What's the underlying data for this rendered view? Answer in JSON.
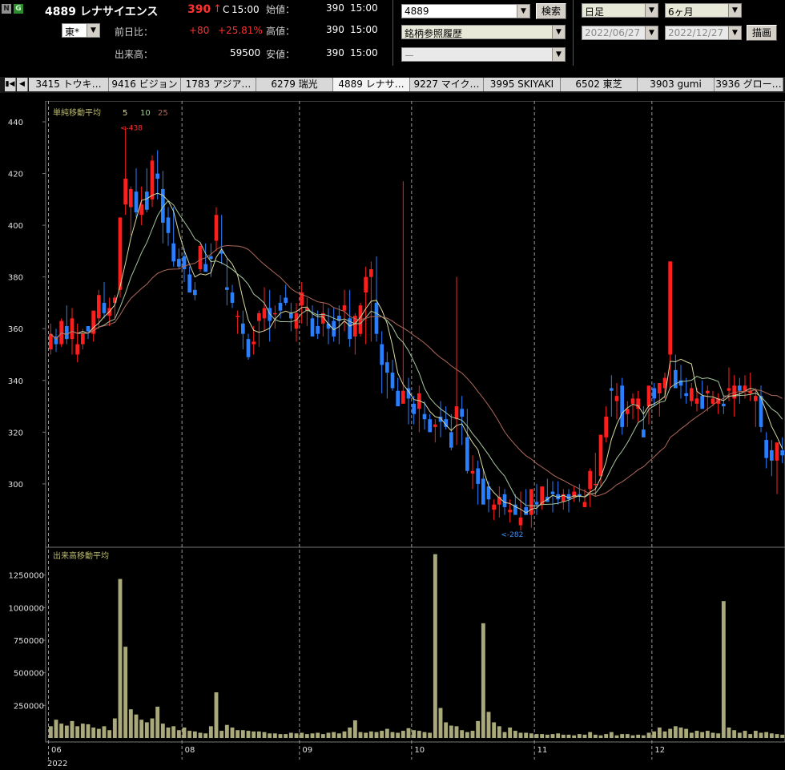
{
  "colors": {
    "up": "#ff1e1e",
    "down": "#2a7fff",
    "ma5": "#d8d8a0",
    "ma10": "#a8c8a0",
    "ma25": "#b06a5a",
    "volume": "#aaa97a",
    "grid": "#777777"
  },
  "header": {
    "badge_n": "N",
    "badge_g": "G",
    "code_name": "4889 レナサイエンス",
    "price": "390",
    "price_arrow": "↑",
    "price_mark": "C",
    "price_time": "15:00",
    "exchange": "東*",
    "change_label": "前日比：",
    "change": "+80",
    "change_pct": "+25.81%",
    "volume_label": "出来高：",
    "volume": "59500",
    "open_label": "始値：",
    "open": "390",
    "open_time": "15:00",
    "high_label": "高値：",
    "high": "390",
    "high_time": "15:00",
    "low_label": "安値：",
    "low": "390",
    "low_time": "15:00",
    "search_value": "4889",
    "search_button": "検索",
    "history_select": "銘柄参照履歴",
    "third_select": "ー",
    "period_select": "日足",
    "range_select": "6ヶ月",
    "date_from": "2022/06/27",
    "date_to": "2022/12/27",
    "draw_button": "描画"
  },
  "tabs": [
    {
      "label": "3415 トウキ…"
    },
    {
      "label": "9416 ビジョン"
    },
    {
      "label": "1783 アジア…"
    },
    {
      "label": "6279 瑞光"
    },
    {
      "label": "4889 レナサ…",
      "active": true
    },
    {
      "label": "9227 マイク…"
    },
    {
      "label": "3995 SKIYAKI"
    },
    {
      "label": "6502 東芝"
    },
    {
      "label": "3903 gumi"
    },
    {
      "label": "3936 グロー…"
    }
  ],
  "chart_data": {
    "type": "candlestick",
    "price_legend": "単純移動平均",
    "ma_periods": [
      "5",
      "10",
      "25"
    ],
    "volume_legend": "出来高移動平均",
    "price_ylim": [
      282,
      440
    ],
    "price_ticks": [
      "440",
      "420",
      "400",
      "380",
      "360",
      "340",
      "320",
      "300"
    ],
    "volume_ylim": [
      0,
      1500000
    ],
    "volume_ticks": [
      "1250000",
      "1000000",
      "750000",
      "500000",
      "250000"
    ],
    "month_labels": [
      {
        "label": "06",
        "index": 0
      },
      {
        "label": "08",
        "index": 25
      },
      {
        "label": "09",
        "index": 47
      },
      {
        "label": "10",
        "index": 68
      },
      {
        "label": "11",
        "index": 91
      },
      {
        "label": "12",
        "index": 113
      }
    ],
    "year_label": "2022",
    "high_marker": "438",
    "high_marker_index": 13,
    "low_marker": "282",
    "low_marker_index": 84,
    "candles": [
      [
        352,
        362,
        350,
        358
      ],
      [
        357,
        360,
        351,
        354
      ],
      [
        354,
        364,
        353,
        363
      ],
      [
        361,
        369,
        354,
        356
      ],
      [
        356,
        368,
        350,
        364
      ],
      [
        350,
        362,
        347,
        354
      ],
      [
        354,
        360,
        352,
        358
      ],
      [
        361,
        360,
        356,
        359
      ],
      [
        358,
        362,
        355,
        367
      ],
      [
        364,
        375,
        360,
        373
      ],
      [
        370,
        378,
        364,
        366
      ],
      [
        365,
        372,
        361,
        368
      ],
      [
        370,
        373,
        364,
        372
      ],
      [
        375,
        390,
        372,
        403
      ],
      [
        408,
        438,
        404,
        418
      ],
      [
        407,
        415,
        396,
        414
      ],
      [
        413,
        422,
        403,
        405
      ],
      [
        404,
        415,
        400,
        408
      ],
      [
        413,
        422,
        405,
        406
      ],
      [
        410,
        427,
        407,
        425
      ],
      [
        420,
        429,
        410,
        418
      ],
      [
        414,
        421,
        393,
        401
      ],
      [
        403,
        407,
        392,
        397
      ],
      [
        393,
        407,
        384,
        386
      ],
      [
        387,
        391,
        383,
        384
      ],
      [
        388,
        391,
        378,
        383
      ],
      [
        381,
        384,
        374,
        374
      ],
      [
        375,
        378,
        371,
        373
      ],
      [
        383,
        393,
        382,
        392
      ],
      [
        385,
        393,
        383,
        382
      ],
      [
        388,
        393,
        380,
        387
      ],
      [
        394,
        407,
        390,
        404
      ],
      [
        390,
        404,
        385,
        389
      ],
      [
        376,
        387,
        369,
        375
      ],
      [
        374,
        377,
        368,
        370
      ],
      [
        365,
        367,
        358,
        365
      ],
      [
        362,
        367,
        352,
        358
      ],
      [
        356,
        358,
        348,
        349
      ],
      [
        354,
        361,
        350,
        355
      ],
      [
        363,
        367,
        353,
        366
      ],
      [
        364,
        376,
        359,
        368
      ],
      [
        368,
        375,
        355,
        363
      ],
      [
        366,
        369,
        360,
        366
      ],
      [
        370,
        373,
        364,
        367
      ],
      [
        372,
        377,
        369,
        370
      ],
      [
        366,
        370,
        359,
        364
      ],
      [
        360,
        370,
        355,
        366
      ],
      [
        369,
        378,
        362,
        374
      ],
      [
        367,
        372,
        361,
        368
      ],
      [
        364,
        369,
        357,
        357
      ],
      [
        361,
        367,
        356,
        358
      ],
      [
        362,
        370,
        357,
        366
      ],
      [
        362,
        368,
        354,
        360
      ],
      [
        363,
        368,
        355,
        357
      ],
      [
        365,
        369,
        354,
        363
      ],
      [
        367,
        375,
        359,
        369
      ],
      [
        364,
        375,
        353,
        356
      ],
      [
        357,
        366,
        350,
        365
      ],
      [
        358,
        370,
        357,
        369
      ],
      [
        374,
        384,
        354,
        380
      ],
      [
        380,
        386,
        355,
        383
      ],
      [
        370,
        388,
        355,
        358
      ],
      [
        354,
        359,
        335,
        346
      ],
      [
        347,
        351,
        333,
        343
      ],
      [
        343,
        348,
        336,
        337
      ],
      [
        336,
        341,
        330,
        330
      ],
      [
        331,
        417,
        331,
        336
      ],
      [
        337,
        341,
        323,
        333
      ],
      [
        331,
        334,
        323,
        327
      ],
      [
        329,
        338,
        320,
        335
      ],
      [
        327,
        332,
        321,
        325
      ],
      [
        325,
        327,
        320,
        320
      ],
      [
        322,
        325,
        316,
        323
      ],
      [
        326,
        332,
        318,
        324
      ],
      [
        325,
        330,
        321,
        322
      ],
      [
        320,
        327,
        313,
        314
      ],
      [
        325,
        380,
        315,
        330
      ],
      [
        329,
        334,
        315,
        326
      ],
      [
        318,
        329,
        304,
        305
      ],
      [
        304,
        311,
        298,
        305
      ],
      [
        306,
        309,
        292,
        300
      ],
      [
        302,
        306,
        295,
        292
      ],
      [
        299,
        301,
        289,
        294
      ],
      [
        290,
        294,
        286,
        292
      ],
      [
        292,
        299,
        287,
        295
      ],
      [
        296,
        298,
        288,
        291
      ],
      [
        289,
        294,
        285,
        290
      ],
      [
        292,
        296,
        289,
        288
      ],
      [
        284,
        297,
        282,
        287
      ],
      [
        291,
        298,
        290,
        288
      ],
      [
        288,
        295,
        283,
        298
      ],
      [
        293,
        300,
        288,
        292
      ],
      [
        292,
        296,
        290,
        299
      ],
      [
        295,
        302,
        294,
        293
      ],
      [
        297,
        301,
        289,
        296
      ],
      [
        296,
        301,
        292,
        294
      ],
      [
        293,
        298,
        290,
        296
      ],
      [
        296,
        298,
        289,
        294
      ],
      [
        295,
        299,
        293,
        297
      ],
      [
        296,
        300,
        293,
        295
      ],
      [
        291,
        298,
        291,
        293
      ],
      [
        298,
        306,
        291,
        305
      ],
      [
        300,
        312,
        295,
        300
      ],
      [
        303,
        315,
        299,
        319
      ],
      [
        318,
        330,
        316,
        326
      ],
      [
        337,
        342,
        326,
        336
      ],
      [
        332,
        339,
        325,
        334
      ],
      [
        338,
        341,
        319,
        322
      ],
      [
        327,
        332,
        322,
        329
      ],
      [
        331,
        335,
        325,
        333
      ],
      [
        329,
        336,
        324,
        333
      ],
      [
        321,
        330,
        318,
        318
      ],
      [
        330,
        335,
        323,
        338
      ],
      [
        337,
        339,
        330,
        333
      ],
      [
        335,
        339,
        326,
        339
      ],
      [
        337,
        343,
        333,
        341
      ],
      [
        350,
        386,
        337,
        386
      ],
      [
        344,
        350,
        337,
        337
      ],
      [
        340,
        346,
        333,
        338
      ],
      [
        335,
        341,
        331,
        334
      ],
      [
        332,
        339,
        330,
        337
      ],
      [
        331,
        337,
        328,
        333
      ],
      [
        334,
        340,
        330,
        329
      ],
      [
        335,
        338,
        328,
        336
      ],
      [
        331,
        336,
        330,
        333
      ],
      [
        331,
        335,
        327,
        333
      ],
      [
        331,
        334,
        327,
        330
      ],
      [
        336,
        345,
        332,
        337
      ],
      [
        333,
        342,
        326,
        338
      ],
      [
        338,
        341,
        331,
        336
      ],
      [
        336,
        342,
        333,
        338
      ],
      [
        335,
        343,
        332,
        336
      ],
      [
        332,
        337,
        322,
        334
      ],
      [
        334,
        338,
        320,
        322
      ],
      [
        317,
        320,
        306,
        310
      ],
      [
        313,
        317,
        303,
        309
      ],
      [
        309,
        315,
        296,
        316
      ],
      [
        313,
        318,
        308,
        311
      ]
    ],
    "volume": [
      90,
      140,
      110,
      95,
      130,
      90,
      110,
      105,
      80,
      70,
      90,
      60,
      150,
      1220,
      700,
      220,
      180,
      140,
      120,
      150,
      240,
      110,
      80,
      90,
      60,
      80,
      55,
      50,
      40,
      35,
      90,
      350,
      55,
      100,
      80,
      60,
      60,
      55,
      50,
      50,
      45,
      35,
      35,
      30,
      30,
      40,
      35,
      40,
      30,
      35,
      40,
      30,
      40,
      45,
      35,
      50,
      80,
      135,
      45,
      40,
      50,
      45,
      55,
      70,
      45,
      40,
      55,
      75,
      60,
      55,
      45,
      40,
      1410,
      230,
      120,
      95,
      90,
      60,
      45,
      55,
      130,
      880,
      200,
      120,
      90,
      45,
      80,
      55,
      40,
      40,
      35,
      30,
      30,
      25,
      30,
      35,
      25,
      25,
      20,
      30,
      25,
      45,
      25,
      20,
      30,
      45,
      20,
      30,
      30,
      20,
      25,
      20,
      40,
      50,
      80,
      50,
      70,
      90,
      80,
      70,
      40,
      55,
      45,
      55,
      40,
      35,
      1050,
      80,
      60,
      40,
      55,
      30,
      55,
      40,
      45,
      35,
      30,
      25,
      30,
      35,
      45,
      40,
      60,
      30,
      25,
      45,
      60,
      40
    ]
  }
}
